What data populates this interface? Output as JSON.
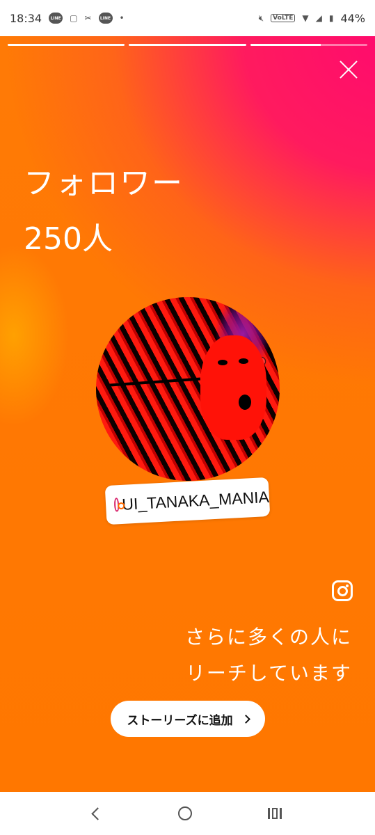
{
  "status_bar": {
    "time": "18:34",
    "notification_icons": [
      "line-icon",
      "notes-icon",
      "capcut-icon",
      "line-icon",
      "dot-icon"
    ],
    "line_label": "LINE",
    "volte": "VoLTE",
    "battery": "44%"
  },
  "story": {
    "progress": [
      1.0,
      1.0,
      0.6
    ],
    "headline_line1": "フォロワー",
    "headline_line2": "250人",
    "username_tag": "UI_TANAKA_MANIA",
    "reach_line1": "さらに多くの人に",
    "reach_line2": "リーチしています",
    "add_to_story_label": "ストーリーズに追加",
    "colors": {
      "gradient_orange": "#ff7a00",
      "gradient_pink": "#ff0a6e",
      "threads_icon": "#d8226a"
    }
  }
}
